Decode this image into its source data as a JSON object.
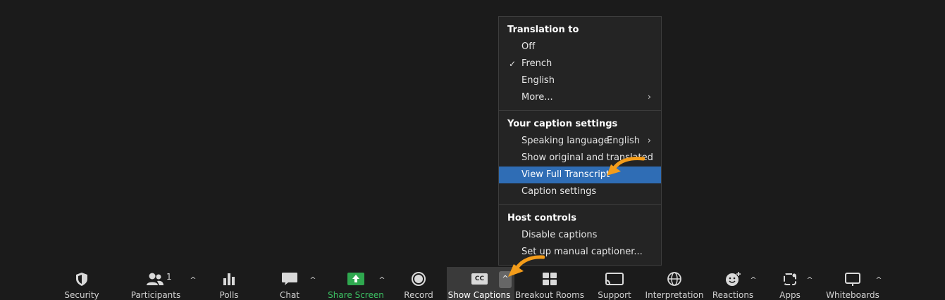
{
  "menu": {
    "translation": {
      "title": "Translation to",
      "items": [
        {
          "label": "Off"
        },
        {
          "label": "French",
          "checked": true
        },
        {
          "label": "English"
        },
        {
          "label": "More..."
        }
      ]
    },
    "caption_settings": {
      "title": "Your caption settings",
      "speaking_language_label": "Speaking language:",
      "speaking_language_value": "English",
      "show_original": "Show original and translated",
      "view_full_transcript": "View Full Transcript",
      "caption_settings_item": "Caption settings"
    },
    "host_controls": {
      "title": "Host controls",
      "disable_captions": "Disable captions",
      "manual_captioner": "Set up manual captioner..."
    }
  },
  "toolbar": {
    "security": "Security",
    "participants": "Participants",
    "participants_count": "1",
    "polls": "Polls",
    "chat": "Chat",
    "share_screen": "Share Screen",
    "record": "Record",
    "show_captions": "Show Captions",
    "cc_badge": "CC",
    "breakout_rooms": "Breakout Rooms",
    "support": "Support",
    "interpretation": "Interpretation",
    "reactions": "Reactions",
    "apps": "Apps",
    "whiteboards": "Whiteboards"
  },
  "colors": {
    "background": "#1b1b1b",
    "menu_bg": "#242424",
    "highlight": "#2f6db5",
    "share_green": "#2fa84f",
    "annotation_arrow": "#f39c1a"
  }
}
